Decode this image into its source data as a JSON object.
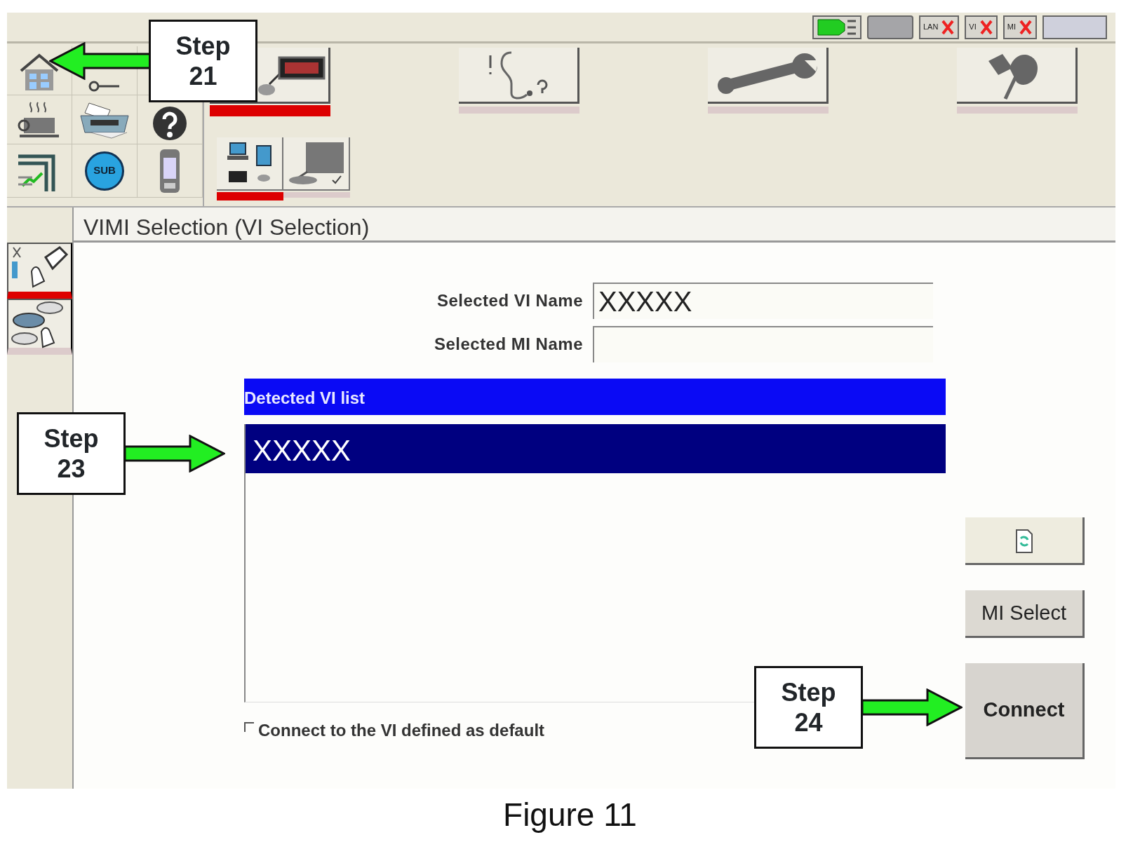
{
  "status_indicators": [
    {
      "label": "LAN",
      "connected": false
    },
    {
      "label": "VI",
      "connected": false
    },
    {
      "label": "MI",
      "connected": false
    }
  ],
  "toolbar": {
    "sub_label": "SUB",
    "main_tabs": [
      {
        "selected": true
      },
      {
        "selected": false
      },
      {
        "selected": false
      },
      {
        "selected": false
      }
    ],
    "sub_tabs": [
      {
        "selected": true
      },
      {
        "selected": false
      }
    ]
  },
  "sidebar": {
    "items": [
      {
        "selected": true
      },
      {
        "selected": false
      }
    ]
  },
  "screen_title": "VIMI Selection (VI Selection)",
  "fields": [
    {
      "label": "Selected VI Name",
      "value": "XXXXX"
    },
    {
      "label": "Selected MI Name"
    }
  ],
  "vi_list": {
    "header": "Detected VI list",
    "rows": [
      {
        "name": "XXXXX",
        "selected": true
      }
    ]
  },
  "default_checkbox": {
    "label": "Connect to the VI defined as default",
    "checked": false
  },
  "buttons": [
    {
      "kind": "icon"
    },
    {
      "kind": "text",
      "label": "MI Select"
    },
    {
      "kind": "text",
      "label": "Connect"
    }
  ],
  "callouts": [
    {
      "kind": "step21",
      "text": "Step\n21"
    },
    {
      "kind": "step23",
      "text": "Step\n23"
    },
    {
      "kind": "step24",
      "text": "Step\n24"
    }
  ],
  "caption": "Figure 11"
}
